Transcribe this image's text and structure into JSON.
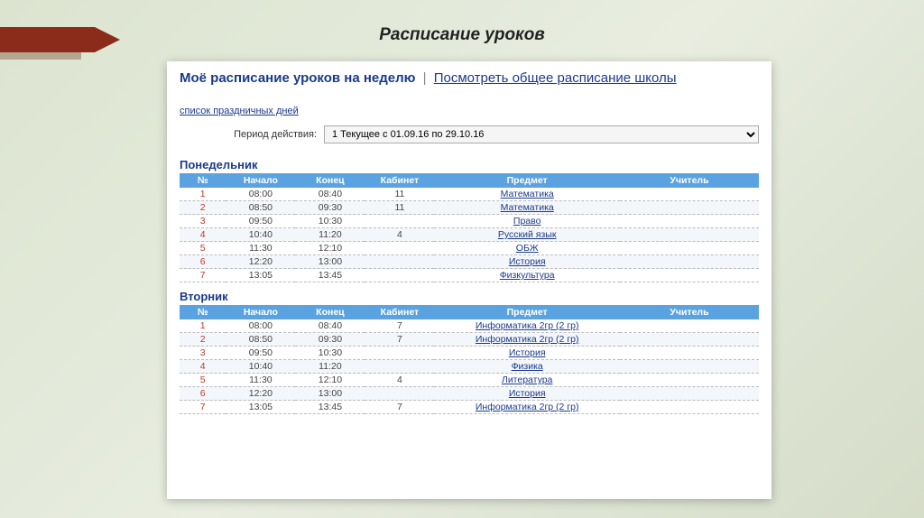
{
  "slide_title": "Расписание уроков",
  "heading": {
    "main": "Моё расписание уроков на неделю",
    "divider": "|",
    "link": "Посмотреть общее расписание школы"
  },
  "holiday_link": "список праздничных дней",
  "period": {
    "label": "Период действия:",
    "selected": "1 Текущее с 01.09.16 по 29.10.16"
  },
  "columns": {
    "num": "№",
    "start": "Начало",
    "end": "Конец",
    "room": "Кабинет",
    "subject": "Предмет",
    "teacher": "Учитель"
  },
  "days": [
    {
      "name": "Понедельник",
      "rows": [
        {
          "n": "1",
          "start": "08:00",
          "end": "08:40",
          "room": "11",
          "subject": "Математика",
          "teacher": ""
        },
        {
          "n": "2",
          "start": "08:50",
          "end": "09:30",
          "room": "11",
          "subject": "Математика",
          "teacher": ""
        },
        {
          "n": "3",
          "start": "09:50",
          "end": "10:30",
          "room": "",
          "subject": "Право",
          "teacher": ""
        },
        {
          "n": "4",
          "start": "10:40",
          "end": "11:20",
          "room": "4",
          "subject": "Русский язык",
          "teacher": ""
        },
        {
          "n": "5",
          "start": "11:30",
          "end": "12:10",
          "room": "",
          "subject": "ОБЖ",
          "teacher": ""
        },
        {
          "n": "6",
          "start": "12:20",
          "end": "13:00",
          "room": "",
          "subject": "История",
          "teacher": ""
        },
        {
          "n": "7",
          "start": "13:05",
          "end": "13:45",
          "room": "",
          "subject": "Физкультура",
          "teacher": ""
        }
      ]
    },
    {
      "name": "Вторник",
      "rows": [
        {
          "n": "1",
          "start": "08:00",
          "end": "08:40",
          "room": "7",
          "subject": "Информатика 2гр (2 гр)",
          "teacher": ""
        },
        {
          "n": "2",
          "start": "08:50",
          "end": "09:30",
          "room": "7",
          "subject": "Информатика 2гр (2 гр)",
          "teacher": ""
        },
        {
          "n": "3",
          "start": "09:50",
          "end": "10:30",
          "room": "",
          "subject": "История",
          "teacher": ""
        },
        {
          "n": "4",
          "start": "10:40",
          "end": "11:20",
          "room": "",
          "subject": "Физика",
          "teacher": ""
        },
        {
          "n": "5",
          "start": "11:30",
          "end": "12:10",
          "room": "4",
          "subject": "Литература",
          "teacher": ""
        },
        {
          "n": "6",
          "start": "12:20",
          "end": "13:00",
          "room": "",
          "subject": "История",
          "teacher": ""
        },
        {
          "n": "7",
          "start": "13:05",
          "end": "13:45",
          "room": "7",
          "subject": "Информатика 2гр (2 гр)",
          "teacher": ""
        }
      ]
    }
  ]
}
